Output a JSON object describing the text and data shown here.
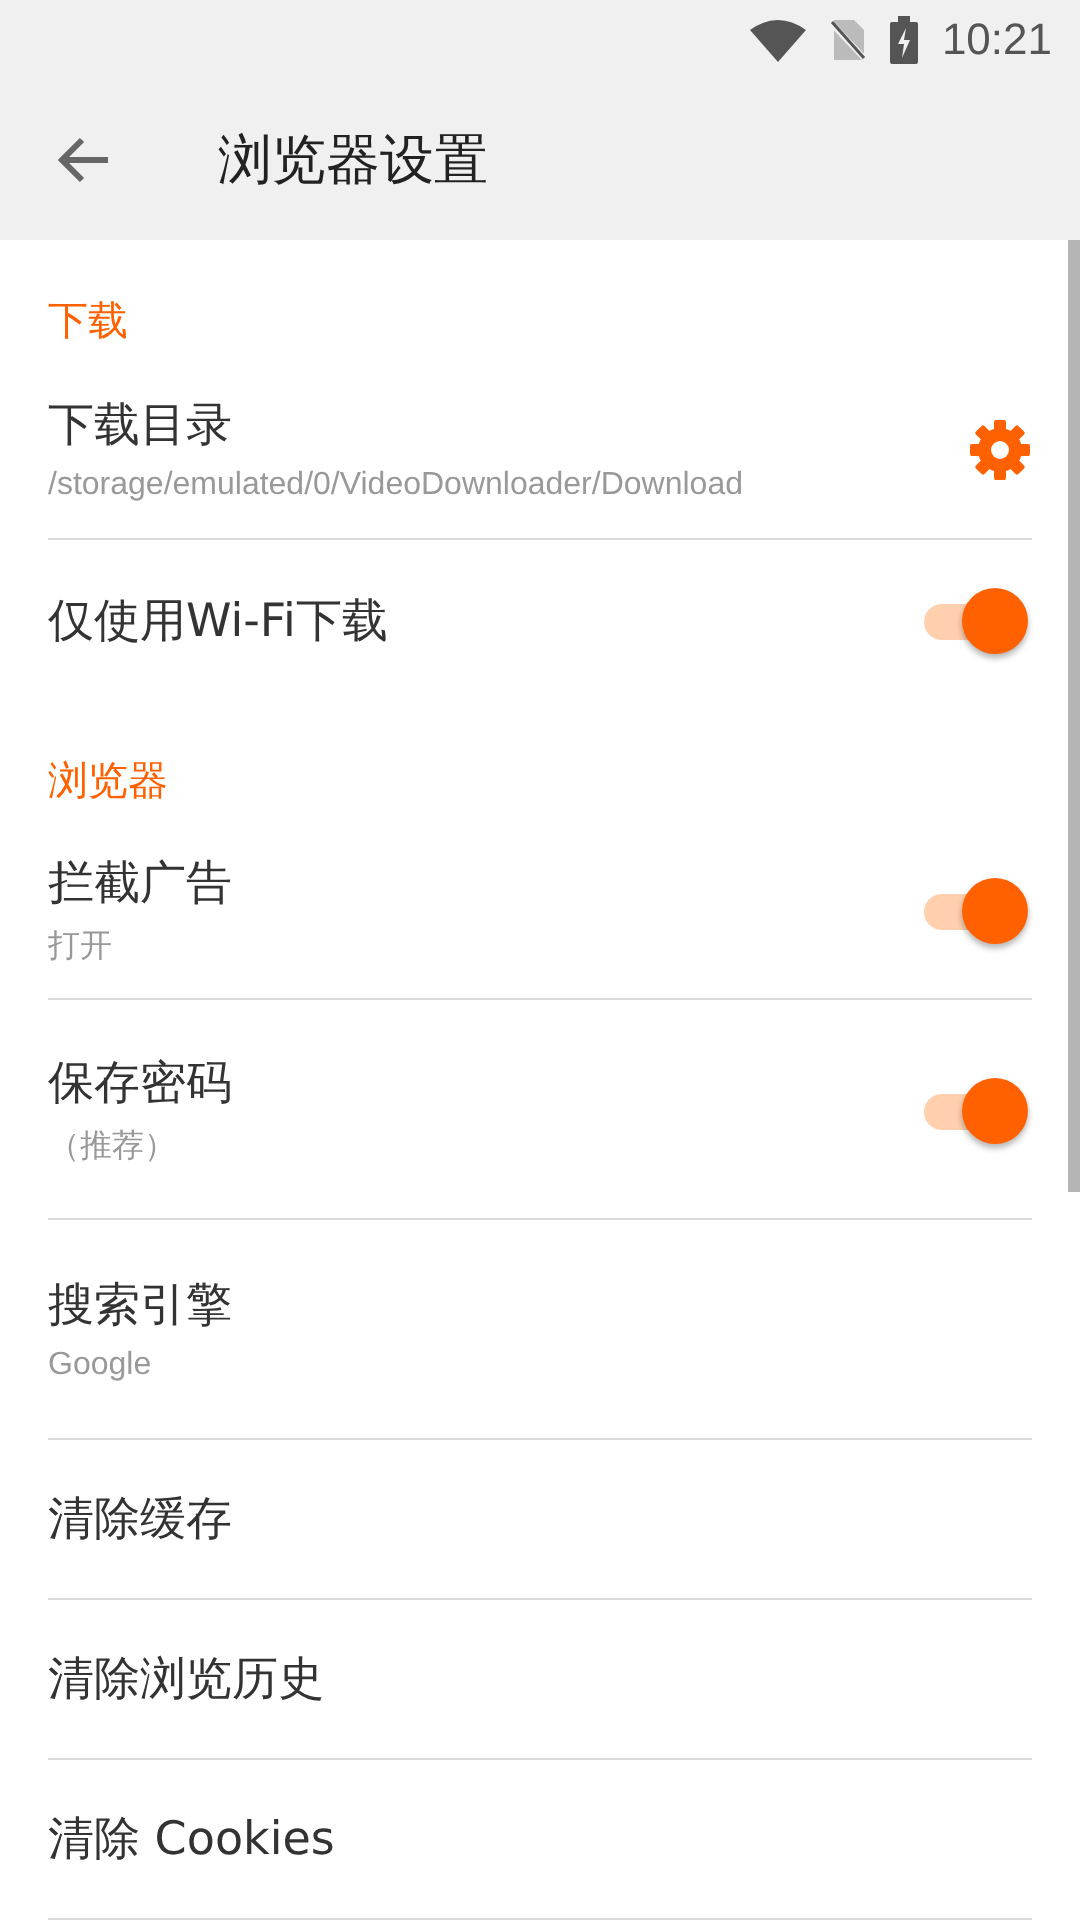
{
  "status_bar": {
    "time": "10:21"
  },
  "toolbar": {
    "title": "浏览器设置"
  },
  "sections": [
    {
      "header": "下载",
      "items": [
        {
          "kind": "gear",
          "title": "下载目录",
          "subtitle": "/storage/emulated/0/VideoDownloader/Download"
        },
        {
          "kind": "toggle",
          "title": "仅使用Wi-Fi下载",
          "on": true
        }
      ]
    },
    {
      "header": "浏览器",
      "items": [
        {
          "kind": "toggle",
          "title": "拦截广告",
          "subtitle": "打开",
          "on": true
        },
        {
          "kind": "toggle",
          "title": "保存密码",
          "subtitle": "（推荐）",
          "on": true
        },
        {
          "kind": "plain",
          "title": "搜索引擎",
          "subtitle": "Google"
        },
        {
          "kind": "plain",
          "title": "清除缓存"
        },
        {
          "kind": "plain",
          "title": "清除浏览历史"
        },
        {
          "kind": "plain",
          "title": "清除 Cookies"
        }
      ]
    }
  ]
}
